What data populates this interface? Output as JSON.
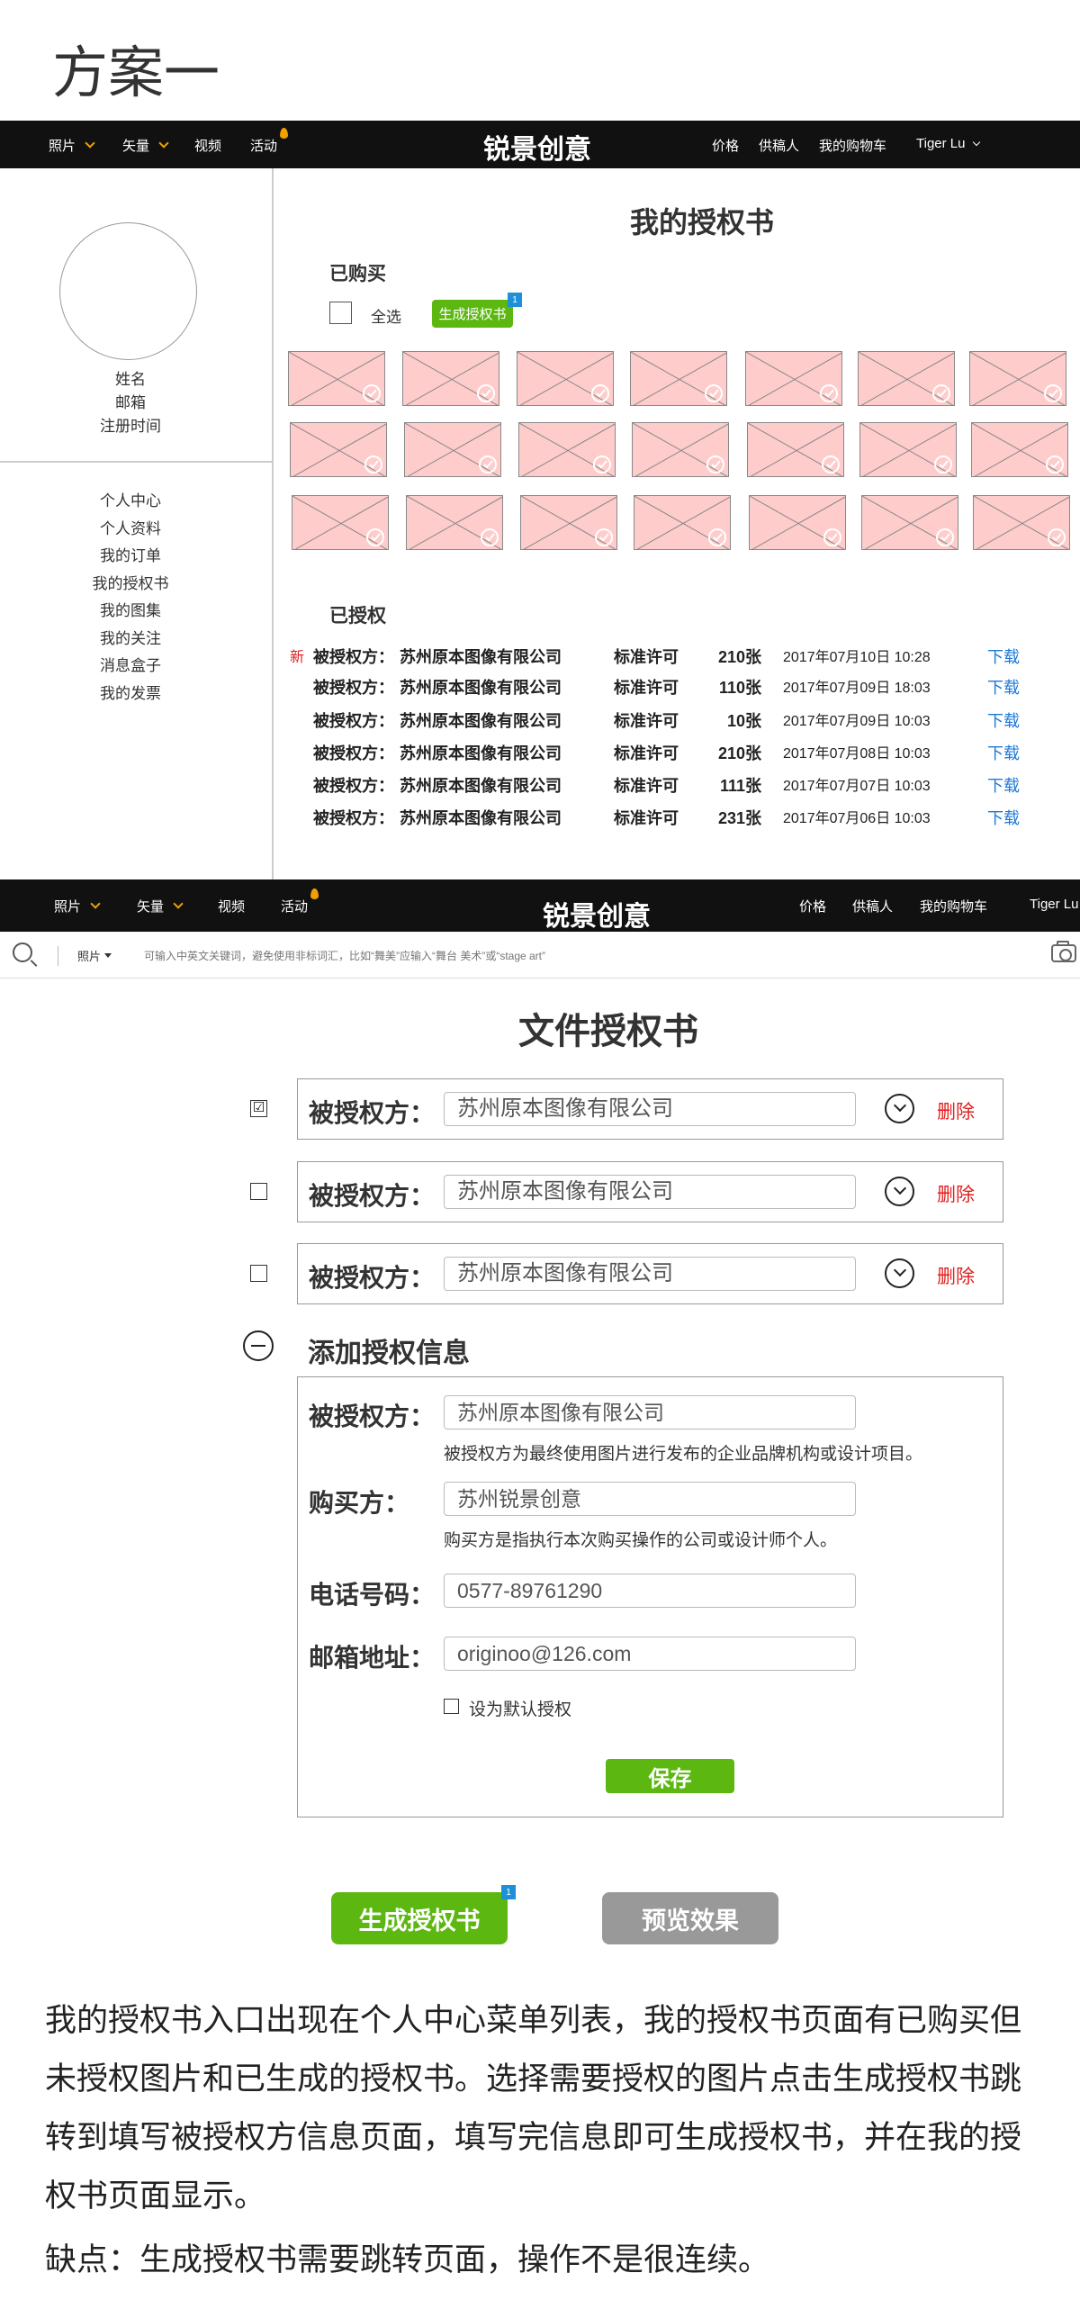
{
  "page_heading": "方案一",
  "nav1": {
    "items": [
      {
        "label": "照片",
        "dropdown": true
      },
      {
        "label": "矢量",
        "dropdown": true
      },
      {
        "label": "视频",
        "dropdown": false
      },
      {
        "label": "活动",
        "dropdown": false
      }
    ],
    "brand": "锐景创意",
    "right": [
      "价格",
      "供稿人",
      "我的购物车"
    ],
    "user": "Tiger Lu"
  },
  "profile": {
    "name": "姓名",
    "email": "邮箱",
    "registered": "注册时间"
  },
  "side_menu": [
    "个人中心",
    "个人资料",
    "我的订单",
    "我的授权书",
    "我的图集",
    "我的关注",
    "消息盒子",
    "我的发票"
  ],
  "section1": {
    "title": "我的授权书",
    "bought_label": "已购买",
    "select_all": "全选",
    "generate_label": "生成授权书",
    "badge": "1",
    "authed_label": "已授权",
    "rows": [
      {
        "new": "新",
        "label": "被授权方：",
        "company": "苏州原本图像有限公司",
        "license": "标准许可",
        "count": "210张",
        "date": "2017年07月10日 10:28",
        "download": "下载"
      },
      {
        "new": "",
        "label": "被授权方：",
        "company": "苏州原本图像有限公司",
        "license": "标准许可",
        "count": "110张",
        "date": "2017年07月09日 18:03",
        "download": "下载"
      },
      {
        "new": "",
        "label": "被授权方：",
        "company": "苏州原本图像有限公司",
        "license": "标准许可",
        "count": "10张",
        "date": "2017年07月09日 10:03",
        "download": "下载"
      },
      {
        "new": "",
        "label": "被授权方：",
        "company": "苏州原本图像有限公司",
        "license": "标准许可",
        "count": "210张",
        "date": "2017年07月08日 10:03",
        "download": "下载"
      },
      {
        "new": "",
        "label": "被授权方：",
        "company": "苏州原本图像有限公司",
        "license": "标准许可",
        "count": "111张",
        "date": "2017年07月07日 10:03",
        "download": "下载"
      },
      {
        "new": "",
        "label": "被授权方：",
        "company": "苏州原本图像有限公司",
        "license": "标准许可",
        "count": "231张",
        "date": "2017年07月06日 10:03",
        "download": "下载"
      }
    ]
  },
  "nav2": {
    "items": [
      {
        "label": "照片",
        "dropdown": true
      },
      {
        "label": "矢量",
        "dropdown": true
      },
      {
        "label": "视频",
        "dropdown": false
      },
      {
        "label": "活动",
        "dropdown": false
      }
    ],
    "brand": "锐景创意",
    "right": [
      "价格",
      "供稿人",
      "我的购物车"
    ],
    "user": "Tiger Lu"
  },
  "search": {
    "category": "照片",
    "placeholder": "可输入中英文关键词，避免使用非标词汇，比如“舞美”应输入“舞台 美术”或“stage art”"
  },
  "section2": {
    "title": "文件授权书",
    "licensees": [
      {
        "checked": true,
        "label": "被授权方：",
        "value": "苏州原本图像有限公司",
        "delete": "删除"
      },
      {
        "checked": false,
        "label": "被授权方：",
        "value": "苏州原本图像有限公司",
        "delete": "删除"
      },
      {
        "checked": false,
        "label": "被授权方：",
        "value": "苏州原本图像有限公司",
        "delete": "删除"
      }
    ],
    "add_title": "添加授权信息",
    "form": {
      "licensee_label": "被授权方：",
      "licensee_value": "苏州原本图像有限公司",
      "licensee_note": "被授权方为最终使用图片进行发布的企业品牌机构或设计项目。",
      "buyer_label": "购买方：",
      "buyer_value": "苏州锐景创意",
      "buyer_note": "购买方是指执行本次购买操作的公司或设计师个人。",
      "phone_label": "电话号码：",
      "phone_value": "0577-89761290",
      "email_label": "邮箱地址：",
      "email_value": "originoo@126.com",
      "default_label": "设为默认授权",
      "save_label": "保存"
    },
    "generate_label": "生成授权书",
    "badge": "1",
    "preview_label": "预览效果"
  },
  "description": "我的授权书入口出现在个人中心菜单列表，我的授权书页面有已购买但未授权图片和已生成的授权书。选择需要授权的图片点击生成授权书跳转到填写被授权方信息页面，填写完信息即可生成授权书，并在我的授权书页面显示。",
  "drawback": "缺点：生成授权书需要跳转页面，操作不是很连续。",
  "colors": {
    "accent_green": "#5cb811",
    "link_blue": "#1e78d8",
    "danger_red": "#e02020",
    "placeholder_pink": "#ffcccc",
    "nav_bg": "#111111"
  }
}
